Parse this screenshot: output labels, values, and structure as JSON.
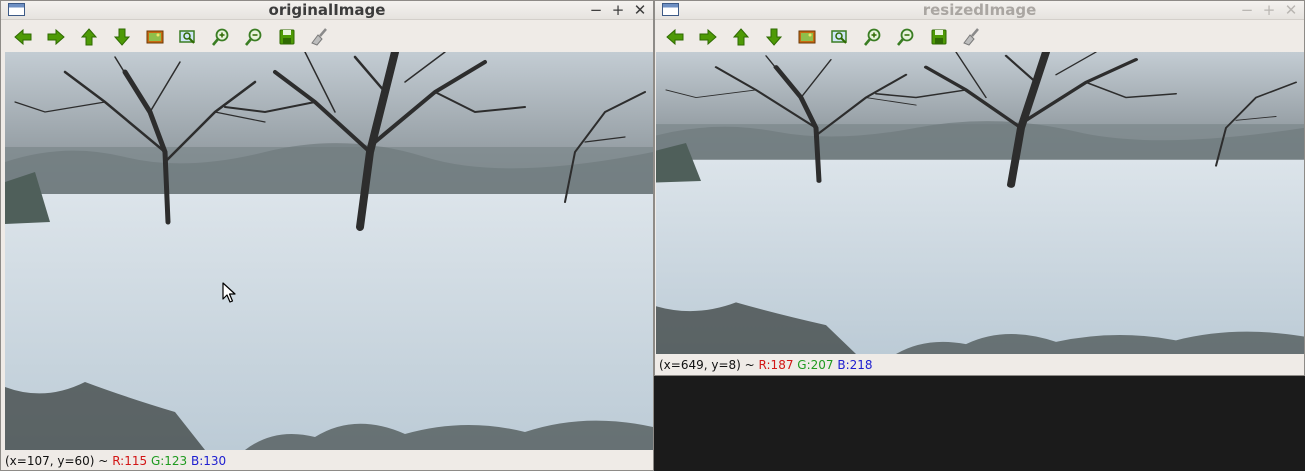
{
  "windows": [
    {
      "title": "originalImage",
      "window_controls": {
        "minimize": "−",
        "maximize": "+",
        "close": "✕"
      },
      "toolbar": [
        "arrow-left-icon",
        "arrow-right-icon",
        "arrow-up-icon",
        "arrow-down-icon",
        "image-icon",
        "zoom-fit-icon",
        "zoom-in-icon",
        "zoom-out-icon",
        "save-icon",
        "brush-icon"
      ],
      "status": {
        "coords": "(x=107, y=60) ~",
        "r": "R:115",
        "g": "G:123",
        "b": "B:130"
      }
    },
    {
      "title": "resizedImage",
      "window_controls": {
        "minimize": "−",
        "maximize": "+",
        "close": "✕"
      },
      "toolbar": [
        "arrow-left-icon",
        "arrow-right-icon",
        "arrow-up-icon",
        "arrow-down-icon",
        "image-icon",
        "zoom-fit-icon",
        "zoom-in-icon",
        "zoom-out-icon",
        "save-icon",
        "brush-icon"
      ],
      "status": {
        "coords": "(x=649, y=8) ~",
        "r": "R:187",
        "g": "G:207",
        "b": "B:218"
      }
    }
  ],
  "colors": {
    "icon_green": "#4e9a06",
    "status_red": "#d21515",
    "status_green": "#1f9a1f",
    "status_blue": "#1d1dd0"
  }
}
